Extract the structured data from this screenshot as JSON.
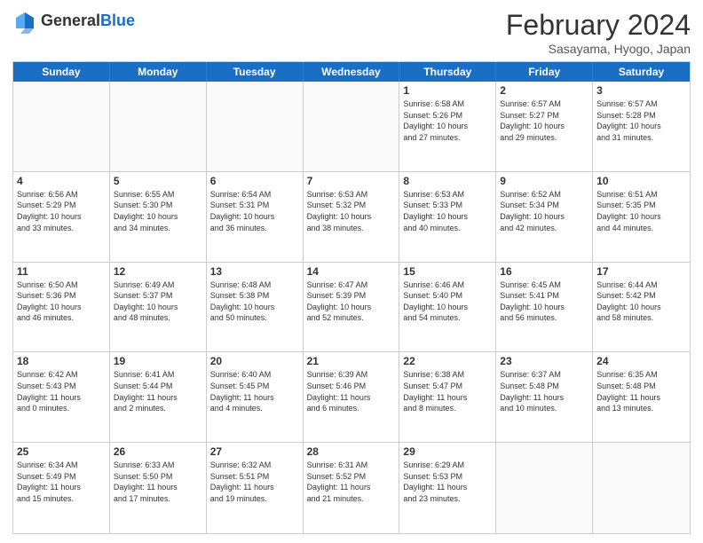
{
  "header": {
    "logo_general": "General",
    "logo_blue": "Blue",
    "title": "February 2024",
    "location": "Sasayama, Hyogo, Japan"
  },
  "days_of_week": [
    "Sunday",
    "Monday",
    "Tuesday",
    "Wednesday",
    "Thursday",
    "Friday",
    "Saturday"
  ],
  "weeks": [
    [
      {
        "day": "",
        "text": "",
        "empty": true
      },
      {
        "day": "",
        "text": "",
        "empty": true
      },
      {
        "day": "",
        "text": "",
        "empty": true
      },
      {
        "day": "",
        "text": "",
        "empty": true
      },
      {
        "day": "1",
        "text": "Sunrise: 6:58 AM\nSunset: 5:26 PM\nDaylight: 10 hours\nand 27 minutes.",
        "empty": false
      },
      {
        "day": "2",
        "text": "Sunrise: 6:57 AM\nSunset: 5:27 PM\nDaylight: 10 hours\nand 29 minutes.",
        "empty": false
      },
      {
        "day": "3",
        "text": "Sunrise: 6:57 AM\nSunset: 5:28 PM\nDaylight: 10 hours\nand 31 minutes.",
        "empty": false
      }
    ],
    [
      {
        "day": "4",
        "text": "Sunrise: 6:56 AM\nSunset: 5:29 PM\nDaylight: 10 hours\nand 33 minutes.",
        "empty": false
      },
      {
        "day": "5",
        "text": "Sunrise: 6:55 AM\nSunset: 5:30 PM\nDaylight: 10 hours\nand 34 minutes.",
        "empty": false
      },
      {
        "day": "6",
        "text": "Sunrise: 6:54 AM\nSunset: 5:31 PM\nDaylight: 10 hours\nand 36 minutes.",
        "empty": false
      },
      {
        "day": "7",
        "text": "Sunrise: 6:53 AM\nSunset: 5:32 PM\nDaylight: 10 hours\nand 38 minutes.",
        "empty": false
      },
      {
        "day": "8",
        "text": "Sunrise: 6:53 AM\nSunset: 5:33 PM\nDaylight: 10 hours\nand 40 minutes.",
        "empty": false
      },
      {
        "day": "9",
        "text": "Sunrise: 6:52 AM\nSunset: 5:34 PM\nDaylight: 10 hours\nand 42 minutes.",
        "empty": false
      },
      {
        "day": "10",
        "text": "Sunrise: 6:51 AM\nSunset: 5:35 PM\nDaylight: 10 hours\nand 44 minutes.",
        "empty": false
      }
    ],
    [
      {
        "day": "11",
        "text": "Sunrise: 6:50 AM\nSunset: 5:36 PM\nDaylight: 10 hours\nand 46 minutes.",
        "empty": false
      },
      {
        "day": "12",
        "text": "Sunrise: 6:49 AM\nSunset: 5:37 PM\nDaylight: 10 hours\nand 48 minutes.",
        "empty": false
      },
      {
        "day": "13",
        "text": "Sunrise: 6:48 AM\nSunset: 5:38 PM\nDaylight: 10 hours\nand 50 minutes.",
        "empty": false
      },
      {
        "day": "14",
        "text": "Sunrise: 6:47 AM\nSunset: 5:39 PM\nDaylight: 10 hours\nand 52 minutes.",
        "empty": false
      },
      {
        "day": "15",
        "text": "Sunrise: 6:46 AM\nSunset: 5:40 PM\nDaylight: 10 hours\nand 54 minutes.",
        "empty": false
      },
      {
        "day": "16",
        "text": "Sunrise: 6:45 AM\nSunset: 5:41 PM\nDaylight: 10 hours\nand 56 minutes.",
        "empty": false
      },
      {
        "day": "17",
        "text": "Sunrise: 6:44 AM\nSunset: 5:42 PM\nDaylight: 10 hours\nand 58 minutes.",
        "empty": false
      }
    ],
    [
      {
        "day": "18",
        "text": "Sunrise: 6:42 AM\nSunset: 5:43 PM\nDaylight: 11 hours\nand 0 minutes.",
        "empty": false
      },
      {
        "day": "19",
        "text": "Sunrise: 6:41 AM\nSunset: 5:44 PM\nDaylight: 11 hours\nand 2 minutes.",
        "empty": false
      },
      {
        "day": "20",
        "text": "Sunrise: 6:40 AM\nSunset: 5:45 PM\nDaylight: 11 hours\nand 4 minutes.",
        "empty": false
      },
      {
        "day": "21",
        "text": "Sunrise: 6:39 AM\nSunset: 5:46 PM\nDaylight: 11 hours\nand 6 minutes.",
        "empty": false
      },
      {
        "day": "22",
        "text": "Sunrise: 6:38 AM\nSunset: 5:47 PM\nDaylight: 11 hours\nand 8 minutes.",
        "empty": false
      },
      {
        "day": "23",
        "text": "Sunrise: 6:37 AM\nSunset: 5:48 PM\nDaylight: 11 hours\nand 10 minutes.",
        "empty": false
      },
      {
        "day": "24",
        "text": "Sunrise: 6:35 AM\nSunset: 5:48 PM\nDaylight: 11 hours\nand 13 minutes.",
        "empty": false
      }
    ],
    [
      {
        "day": "25",
        "text": "Sunrise: 6:34 AM\nSunset: 5:49 PM\nDaylight: 11 hours\nand 15 minutes.",
        "empty": false
      },
      {
        "day": "26",
        "text": "Sunrise: 6:33 AM\nSunset: 5:50 PM\nDaylight: 11 hours\nand 17 minutes.",
        "empty": false
      },
      {
        "day": "27",
        "text": "Sunrise: 6:32 AM\nSunset: 5:51 PM\nDaylight: 11 hours\nand 19 minutes.",
        "empty": false
      },
      {
        "day": "28",
        "text": "Sunrise: 6:31 AM\nSunset: 5:52 PM\nDaylight: 11 hours\nand 21 minutes.",
        "empty": false
      },
      {
        "day": "29",
        "text": "Sunrise: 6:29 AM\nSunset: 5:53 PM\nDaylight: 11 hours\nand 23 minutes.",
        "empty": false
      },
      {
        "day": "",
        "text": "",
        "empty": true
      },
      {
        "day": "",
        "text": "",
        "empty": true
      }
    ]
  ]
}
